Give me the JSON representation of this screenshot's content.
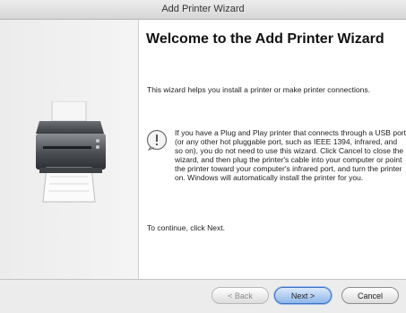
{
  "window": {
    "title": "Add Printer Wizard"
  },
  "content": {
    "heading": "Welcome to the Add Printer Wizard",
    "intro": "This wizard helps you install a printer or make printer connections.",
    "note": "If you have a Plug and Play printer that connects through a USB port (or any other hot pluggable port, such as IEEE 1394, infrared, and so on), you do not need to use this wizard. Click Cancel to close the wizard, and then plug the printer's cable into your computer or point the printer toward your computer's infrared port, and turn the printer on. Windows will automatically install the printer for you.",
    "continue_text": "To continue, click Next."
  },
  "buttons": {
    "back_label": "< Back",
    "next_label": "Next >",
    "cancel_label": "Cancel"
  },
  "icons": {
    "side_image": "printer-icon",
    "note_icon": "info-icon"
  }
}
